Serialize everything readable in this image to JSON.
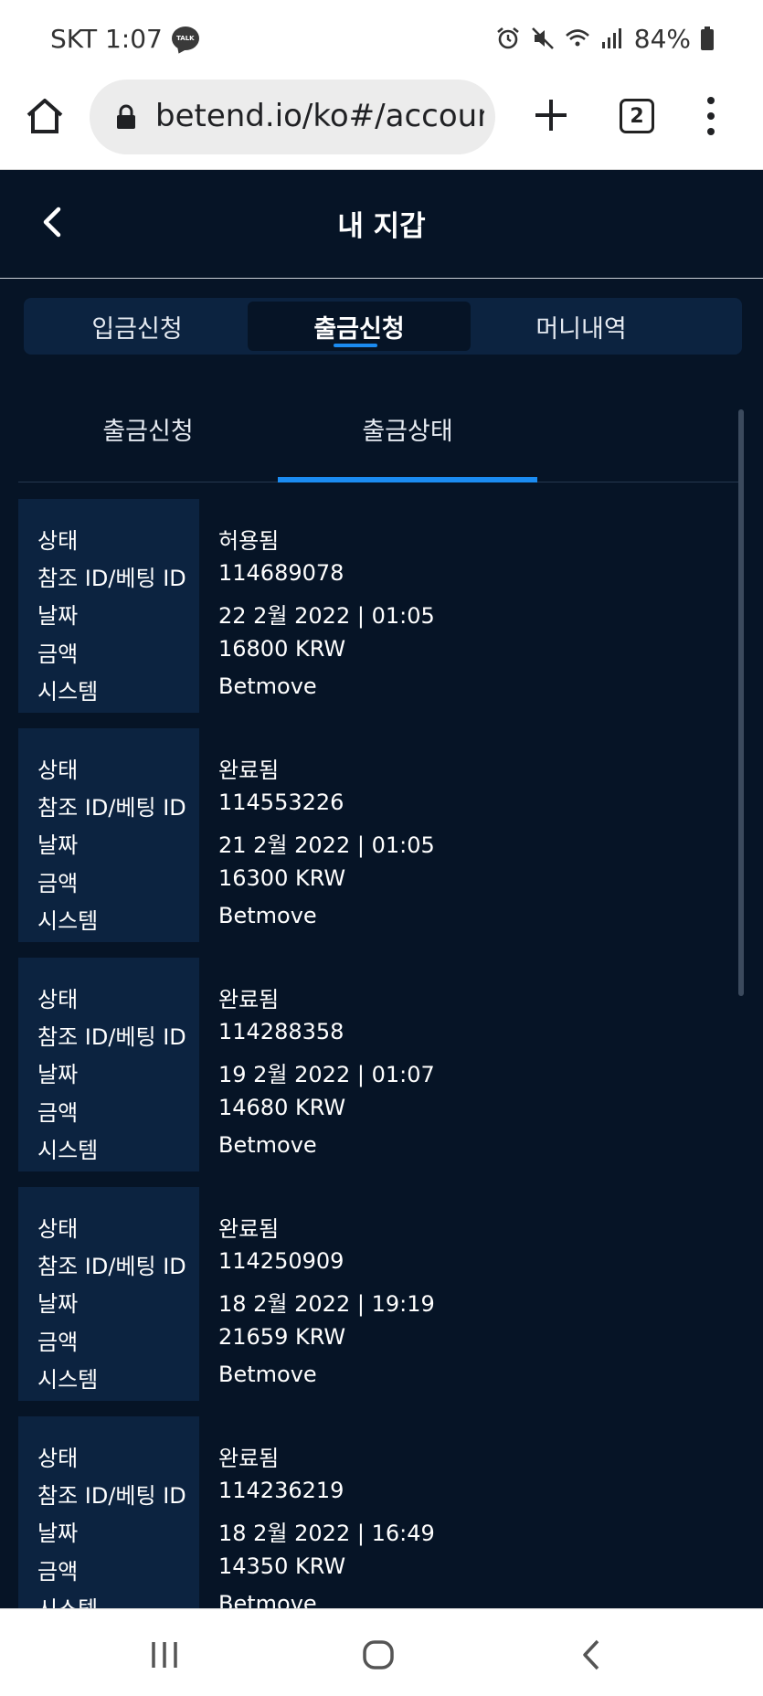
{
  "status_bar": {
    "carrier_time": "SKT 1:07",
    "talk_badge": "TALK",
    "battery": "84%",
    "icons": [
      "kakaotalk-icon",
      "alarm-icon",
      "mute-icon",
      "wifi-icon",
      "signal-icon",
      "battery-icon"
    ]
  },
  "browser": {
    "url": "betend.io/ko#/account",
    "tab_count": "2",
    "icons": [
      "home-icon",
      "lock-icon",
      "plus-icon",
      "kebab-menu-icon"
    ]
  },
  "header": {
    "title": "내 지갑",
    "icons": [
      "back-chevron-icon"
    ]
  },
  "main_tabs": [
    {
      "label": "입금신청",
      "active": false
    },
    {
      "label": "출금신청",
      "active": true
    },
    {
      "label": "머니내역",
      "active": false
    }
  ],
  "sub_tabs": [
    {
      "label": "출금신청",
      "active": false
    },
    {
      "label": "출금상태",
      "active": true
    }
  ],
  "field_labels": {
    "status": "상태",
    "ref_id": "참조 ID/베팅 ID",
    "date": "날짜",
    "amount": "금액",
    "system": "시스템"
  },
  "records": [
    {
      "status": "허용됨",
      "ref_id": "114689078",
      "date": "22 2월 2022 | 01:05",
      "amount": "16800 KRW",
      "system": "Betmove"
    },
    {
      "status": "완료됨",
      "ref_id": "114553226",
      "date": "21 2월 2022 | 01:05",
      "amount": "16300 KRW",
      "system": "Betmove"
    },
    {
      "status": "완료됨",
      "ref_id": "114288358",
      "date": "19 2월 2022 | 01:07",
      "amount": "14680 KRW",
      "system": "Betmove"
    },
    {
      "status": "완료됨",
      "ref_id": "114250909",
      "date": "18 2월 2022 | 19:19",
      "amount": "21659 KRW",
      "system": "Betmove"
    },
    {
      "status": "완료됨",
      "ref_id": "114236219",
      "date": "18 2월 2022 | 16:49",
      "amount": "14350 KRW",
      "system": "Betmove"
    }
  ],
  "colors": {
    "background": "#061426",
    "panel": "#0c2340",
    "accent": "#1b8cf2",
    "text": "#ffffff"
  },
  "nav_bar": {
    "icons": [
      "recent-apps-icon",
      "home-circle-icon",
      "back-icon"
    ]
  }
}
